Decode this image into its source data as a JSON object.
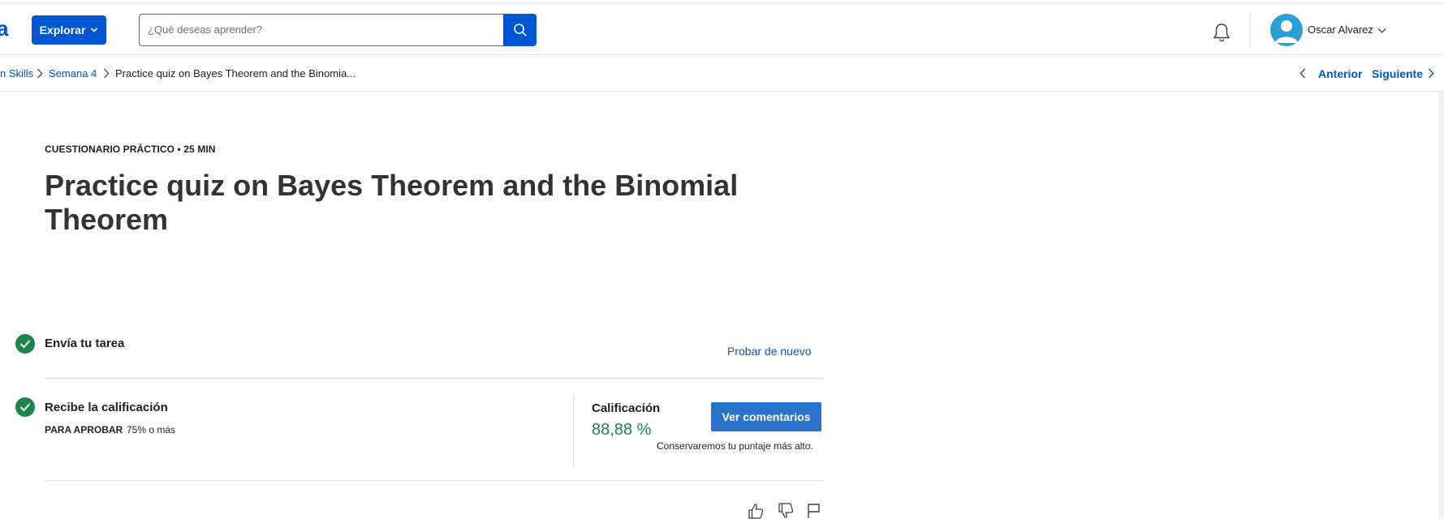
{
  "header": {
    "logo_fragment": "a",
    "explore_label": "Explorar",
    "search": {
      "placeholder": "¿Qué deseas aprender?",
      "value": ""
    },
    "user": {
      "name": "Oscar Alvarez"
    }
  },
  "breadcrumb": {
    "items": [
      {
        "label": "n Skills"
      },
      {
        "label": "Semana 4"
      },
      {
        "label": "Practice quiz on Bayes Theorem and the Binomia..."
      }
    ],
    "prev_label": "Anterior",
    "next_label": "Siguiente"
  },
  "main": {
    "eyebrow": "CUESTIONARIO PRÁCTICO • 25 MIN",
    "title": "Practice quiz on Bayes Theorem and the Binomial Theorem",
    "steps": [
      {
        "title": "Envía tu tarea",
        "action": "Probar de nuevo"
      },
      {
        "title": "Recibe la calificación",
        "pass_label": "PARA APROBAR",
        "pass_value": "75% o más"
      }
    ],
    "grade": {
      "label": "Calificación",
      "value": "88,88 %",
      "button": "Ver comentarios",
      "note": "Conservaremos tu puntaje más alto."
    }
  },
  "icons": {
    "explore_chevron": "chevron-down-icon",
    "search": "search-icon",
    "notifications": "bell-icon",
    "avatar": "user-avatar-icon",
    "user_menu": "chevron-down-icon",
    "crumb_separator": "chevron-right-icon",
    "prev": "chevron-left-icon",
    "next": "chevron-right-icon",
    "step_done": "check-circle-icon",
    "like": "thumbs-up-icon",
    "dislike": "thumbs-down-icon",
    "report": "flag-icon"
  },
  "colors": {
    "brand": "#0056d2",
    "button": "#2a73cc",
    "success": "#1e8449",
    "text": "#1f1f1f",
    "divider": "#dfe2e4"
  }
}
